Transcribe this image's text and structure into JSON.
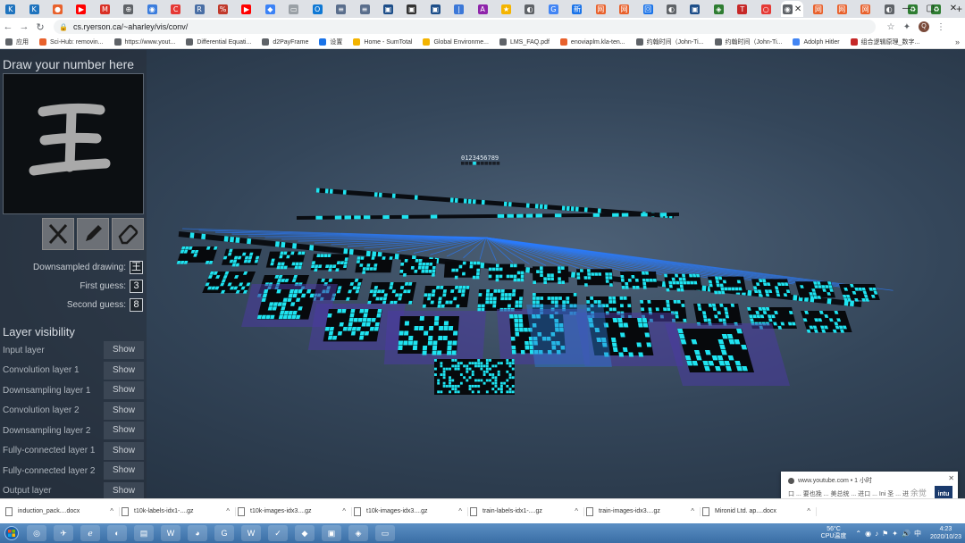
{
  "browser": {
    "tabs": [
      {
        "glyph": "K",
        "color": "#1e73be"
      },
      {
        "glyph": "K",
        "color": "#1e73be"
      },
      {
        "glyph": "●",
        "color": "#e8612c"
      },
      {
        "glyph": "▶",
        "color": "#ff0000"
      },
      {
        "glyph": "M",
        "color": "#d93025"
      },
      {
        "glyph": "⊕",
        "color": "#5f6368"
      },
      {
        "glyph": "◉",
        "color": "#3b7ddd"
      },
      {
        "glyph": "C",
        "color": "#e53935"
      },
      {
        "glyph": "R",
        "color": "#4a6fa5"
      },
      {
        "glyph": "%",
        "color": "#c0392b"
      },
      {
        "glyph": "▶",
        "color": "#ff0000"
      },
      {
        "glyph": "◆",
        "color": "#3b82f6"
      },
      {
        "glyph": "▭",
        "color": "#9aa0a6"
      },
      {
        "glyph": "O",
        "color": "#0f78d4"
      },
      {
        "glyph": "≡",
        "color": "#5a6e8c"
      },
      {
        "glyph": "≡",
        "color": "#5a6e8c"
      },
      {
        "glyph": "▣",
        "color": "#1d4e89"
      },
      {
        "glyph": "▣",
        "color": "#333333"
      },
      {
        "glyph": "▣",
        "color": "#1d4e89"
      },
      {
        "glyph": "|",
        "color": "#3c78d8"
      },
      {
        "glyph": "A",
        "color": "#8e24aa"
      },
      {
        "glyph": "★",
        "color": "#f4b400"
      },
      {
        "glyph": "◐",
        "color": "#5f6368"
      },
      {
        "glyph": "G",
        "color": "#4285f4"
      },
      {
        "glyph": "新",
        "color": "#1a73e8"
      },
      {
        "glyph": "网",
        "color": "#e8612c"
      },
      {
        "glyph": "网",
        "color": "#e8612c"
      },
      {
        "glyph": "回",
        "color": "#1a73e8"
      },
      {
        "glyph": "◐",
        "color": "#5f6368"
      },
      {
        "glyph": "▣",
        "color": "#1d4e89"
      },
      {
        "glyph": "◈",
        "color": "#2e7d32"
      },
      {
        "glyph": "T",
        "color": "#c62828"
      },
      {
        "glyph": "○",
        "color": "#e53935"
      }
    ],
    "active_tab": {
      "glyph": "◉",
      "color": "#5f6368",
      "close": "✕"
    },
    "tabs_after": [
      {
        "glyph": "网",
        "color": "#e8612c"
      },
      {
        "glyph": "网",
        "color": "#e8612c"
      },
      {
        "glyph": "网",
        "color": "#e8612c"
      },
      {
        "glyph": "◐",
        "color": "#5f6368"
      },
      {
        "glyph": "♻",
        "color": "#2e7d32"
      },
      {
        "glyph": "♻",
        "color": "#2e7d32"
      }
    ],
    "new_tab": "+",
    "window_controls": {
      "minimize": "—",
      "maximize": "▢",
      "close": "✕"
    },
    "back": "←",
    "forward": "→",
    "reload": "↻",
    "url": "cs.ryerson.ca/~aharley/vis/conv/",
    "star": "☆",
    "extensions": "✦",
    "profile": "Q",
    "menu": "⋮",
    "bookmarks": [
      {
        "label": "应用",
        "color": "#5f6368"
      },
      {
        "label": "Sci-Hub: removin...",
        "color": "#e8612c"
      },
      {
        "label": "https://www.yout...",
        "color": "#5f6368"
      },
      {
        "label": "Differential Equati...",
        "color": "#5f6368"
      },
      {
        "label": "d2PayFrame",
        "color": "#5f6368"
      },
      {
        "label": "设置",
        "color": "#1a73e8"
      },
      {
        "label": "Home - SumTotal",
        "color": "#f4b400"
      },
      {
        "label": "Global Environme...",
        "color": "#f4b400"
      },
      {
        "label": "LMS_FAQ.pdf",
        "color": "#5f6368"
      },
      {
        "label": "enoviaplm.kla-ten...",
        "color": "#e8612c"
      },
      {
        "label": "约翰时间（John-Ti...",
        "color": "#5f6368"
      },
      {
        "label": "约翰时间（John-Ti...",
        "color": "#5f6368"
      },
      {
        "label": "Adolph Hitler",
        "color": "#4285f4"
      },
      {
        "label": "组合逻辑原理_数字...",
        "color": "#c62828"
      }
    ],
    "bookmarks_more": "»"
  },
  "app": {
    "draw_title": "Draw your number here",
    "stroke_color": "#a9a9a9",
    "tools": {
      "clear": "clear-tool",
      "pencil": "pencil-tool",
      "eraser": "eraser-tool"
    },
    "downsampled_label": "Downsampled drawing:",
    "downsampled_glyph": "王",
    "first_guess_label": "First guess:",
    "first_guess": "3",
    "second_guess_label": "Second guess:",
    "second_guess": "8",
    "layer_visibility_title": "Layer visibility",
    "layers": [
      {
        "label": "Input layer",
        "button": "Show"
      },
      {
        "label": "Convolution layer 1",
        "button": "Show"
      },
      {
        "label": "Downsampling layer 1",
        "button": "Show"
      },
      {
        "label": "Convolution layer 2",
        "button": "Show"
      },
      {
        "label": "Downsampling layer 2",
        "button": "Show"
      },
      {
        "label": "Fully-connected layer 1",
        "button": "Show"
      },
      {
        "label": "Fully-connected layer 2",
        "button": "Show"
      },
      {
        "label": "Output layer",
        "button": "Show"
      }
    ],
    "output_digits": "0123456789",
    "colors": {
      "neuron_active": "#1fe3f0",
      "neuron_off": "#05070a",
      "plane": "#4a3aa0",
      "connection": "#2a7cff"
    }
  },
  "notification": {
    "source": "www.youtube.com • 1 小时",
    "body": "口 ... 要也挽 ... 美总统 ... 进口 ... Ini 圣 ... 进",
    "logo": "intu",
    "close": "✕",
    "watermark": "余觉流年"
  },
  "downloads": [
    {
      "name": "induction_pack....docx"
    },
    {
      "name": "t10k-labels-idx1-....gz"
    },
    {
      "name": "t10k-images-idx3....gz"
    },
    {
      "name": "t10k-images-idx3....gz"
    },
    {
      "name": "train-labels-idx1-....gz"
    },
    {
      "name": "train-images-idx3....gz"
    },
    {
      "name": "Mironid Ltd. ap....docx"
    }
  ],
  "download_chevron": "^",
  "taskbar": {
    "apps": [
      "◎",
      "✈",
      "ℯ",
      "◐",
      "▤",
      "W",
      "◕",
      "G",
      "W",
      "✓",
      "◆",
      "▣",
      "◈",
      "▭"
    ],
    "temperature": "56°C",
    "temperature_label": "CPU温度",
    "time": "4:23",
    "date": "2020/10/23",
    "tray_icons": [
      "⌃",
      "◉",
      "♪",
      "⚑",
      "✦",
      "🔊",
      "中"
    ]
  }
}
